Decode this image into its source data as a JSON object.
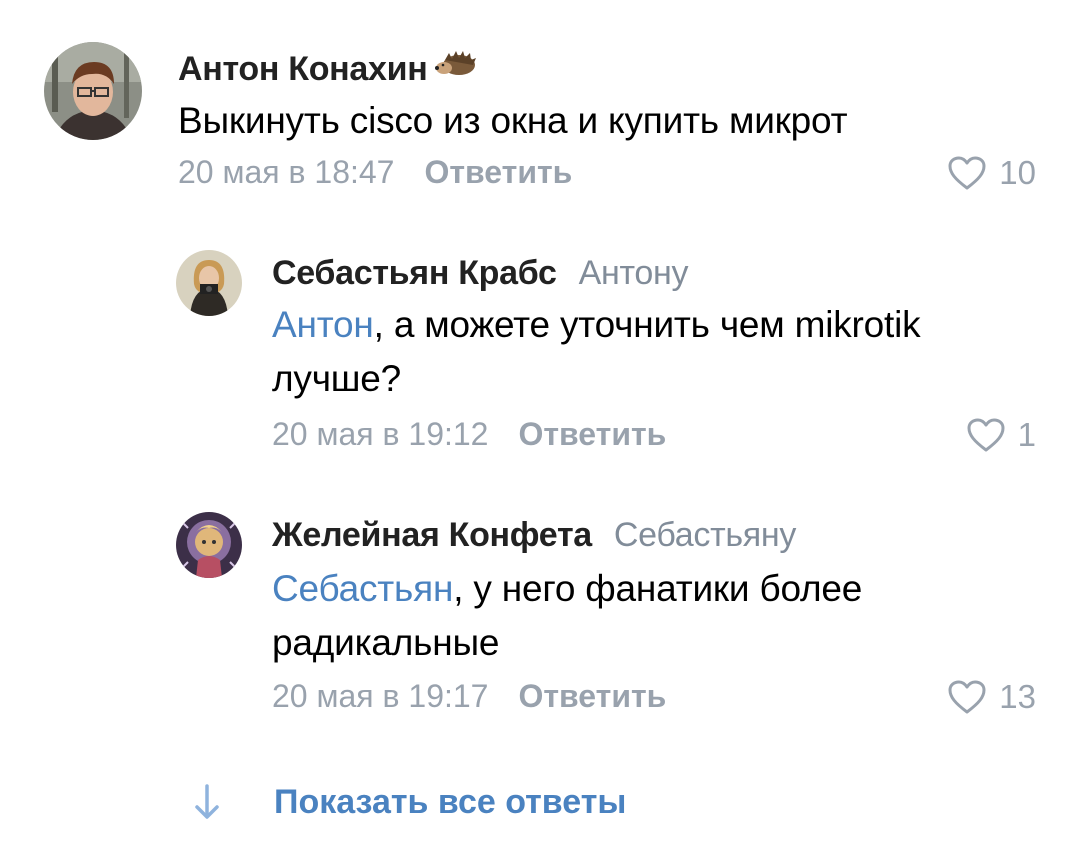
{
  "comments": [
    {
      "author": "Антон Конахин",
      "author_badge_icon": "hedgehog-icon",
      "reply_to": "",
      "mention": "",
      "text": "Выкинуть cisco из окна и купить микрот",
      "date": "20 мая в 18:47",
      "reply_label": "Ответить",
      "likes": "10"
    },
    {
      "author": "Себастьян Крабс",
      "reply_to": "Антону",
      "mention": "Антон",
      "text": ", а можете уточнить чем mikrotik лучше?",
      "date": "20 мая в 19:12",
      "reply_label": "Ответить",
      "likes": "1"
    },
    {
      "author": "Желейная Конфета",
      "reply_to": "Себастьяну",
      "mention": "Себастьян",
      "text": ", у него фанатики более радикальные",
      "date": "20 мая в 19:17",
      "reply_label": "Ответить",
      "likes": "13"
    }
  ],
  "show_all": {
    "label": "Показать все ответы",
    "icon": "arrow-down-icon"
  },
  "colors": {
    "link": "#4a82c0",
    "secondary": "#99a2ad",
    "reply_to": "#818c99"
  }
}
